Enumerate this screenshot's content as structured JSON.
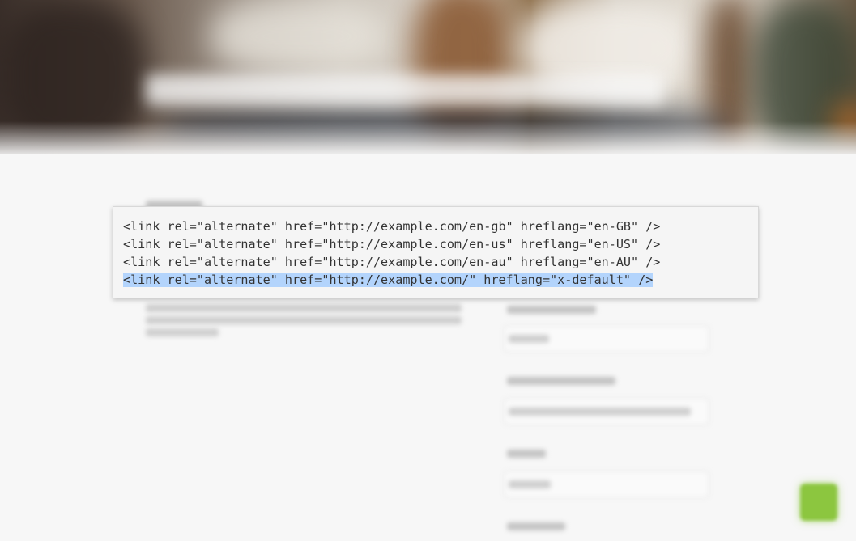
{
  "code_snippet": {
    "lines": [
      "<link rel=\"alternate\" href=\"http://example.com/en-gb\" hreflang=\"en-GB\" />",
      "<link rel=\"alternate\" href=\"http://example.com/en-us\" hreflang=\"en-US\" />",
      "<link rel=\"alternate\" href=\"http://example.com/en-au\" hreflang=\"en-AU\" />",
      "<link rel=\"alternate\" href=\"http://example.com/\" hreflang=\"x-default\" />"
    ],
    "selected_line": 3
  },
  "colors": {
    "selection": "#b3d4fc",
    "accent_button": "#8cc63f",
    "code_background": "#f5f5f5"
  }
}
